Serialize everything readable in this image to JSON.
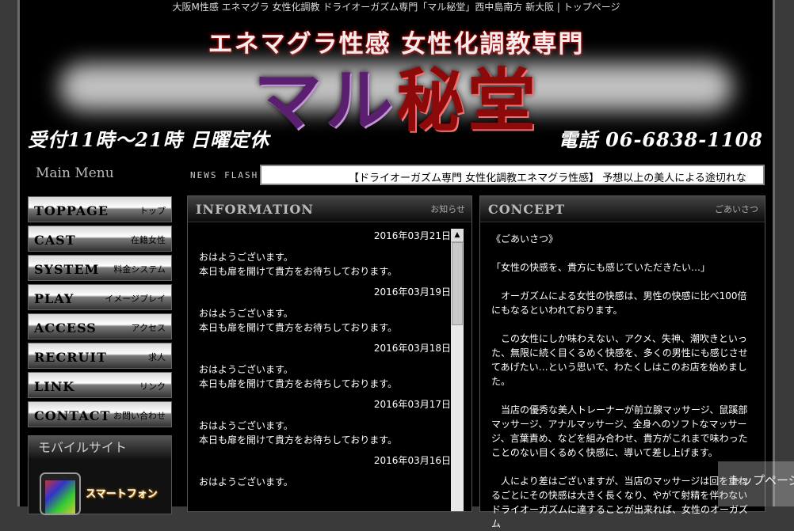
{
  "top_bar": "大阪M性感 エネマグラ 女性化調教 ドライオーガズム専門「マル秘堂」西中島南方 新大阪 | トップページ",
  "header": {
    "sub_title": "エネマグラ性感 女性化調教専門",
    "logo_part1": "マル",
    "logo_part2": "秘堂",
    "hours": "受付11時～21時 日曜定休",
    "tel": "電話 06-6838-1108"
  },
  "menu": {
    "heading": "Main Menu",
    "items": [
      {
        "en": "TOPPAGE",
        "jp": "トップ"
      },
      {
        "en": "CAST",
        "jp": "在籍女性"
      },
      {
        "en": "SYSTEM",
        "jp": "料金システム"
      },
      {
        "en": "PLAY",
        "jp": "イメージプレイ"
      },
      {
        "en": "ACCESS",
        "jp": "アクセス"
      },
      {
        "en": "RECRUIT",
        "jp": "求人"
      },
      {
        "en": "LINK",
        "jp": "リンク"
      },
      {
        "en": "CONTACT",
        "jp": "お問い合わせ"
      }
    ]
  },
  "mobile": {
    "heading": "モバイルサイト",
    "smartphone_label": "スマートフォン"
  },
  "news_flash": {
    "label": "NEWS FLASH",
    "text": "【ドライオーガズム専門 女性化調教エネマグラ性感】 予想以上の美人による途切れな"
  },
  "info": {
    "title": "INFORMATION",
    "sub": "お知らせ",
    "entries": [
      {
        "date": "2016年03月21日",
        "line1": "おはようございます。",
        "line2": "本日も扉を開けて貴方をお待ちしております。"
      },
      {
        "date": "2016年03月19日",
        "line1": "おはようございます。",
        "line2": "本日も扉を開けて貴方をお待ちしております。"
      },
      {
        "date": "2016年03月18日",
        "line1": "おはようございます。",
        "line2": "本日も扉を開けて貴方をお待ちしております。"
      },
      {
        "date": "2016年03月17日",
        "line1": "おはようございます。",
        "line2": "本日も扉を開けて貴方をお待ちしております。"
      },
      {
        "date": "2016年03月16日",
        "line1": "おはようございます。",
        "line2": ""
      }
    ]
  },
  "concept": {
    "title": "CONCEPT",
    "sub": "ごあいさつ",
    "paragraphs": [
      "《ごあいさつ》",
      "「女性の快感を、貴方にも感じていただきたい…」",
      "　オーガズムによる女性の快感は、男性の快感に比べ100倍にもなるといわれております。",
      "　この女性にしか味わえない、アクメ、失神、潮吹きといった、無限に続く目くるめく快感を、多くの男性にも感じさせてあげたい…という思いで、わたくしはこのお店を始めました。",
      "　当店の優秀な美人トレーナーが前立腺マッサージ、鼠蹊部マッサージ、アナルマッサージ、全身へのソフトなマッサージ、言葉責め、などを組み合わせ、貴方がこれまで味わったことのない目くるめく快感に、導いて差し上げます。",
      "　人により差はございますが、当店のマッサージは回を重ねるごとにその快感は大きく長くなり、やがて射精を伴わないドライオーガズムに達することが出来れば、女性のオーガズム"
    ]
  },
  "to_top": "トップページ"
}
